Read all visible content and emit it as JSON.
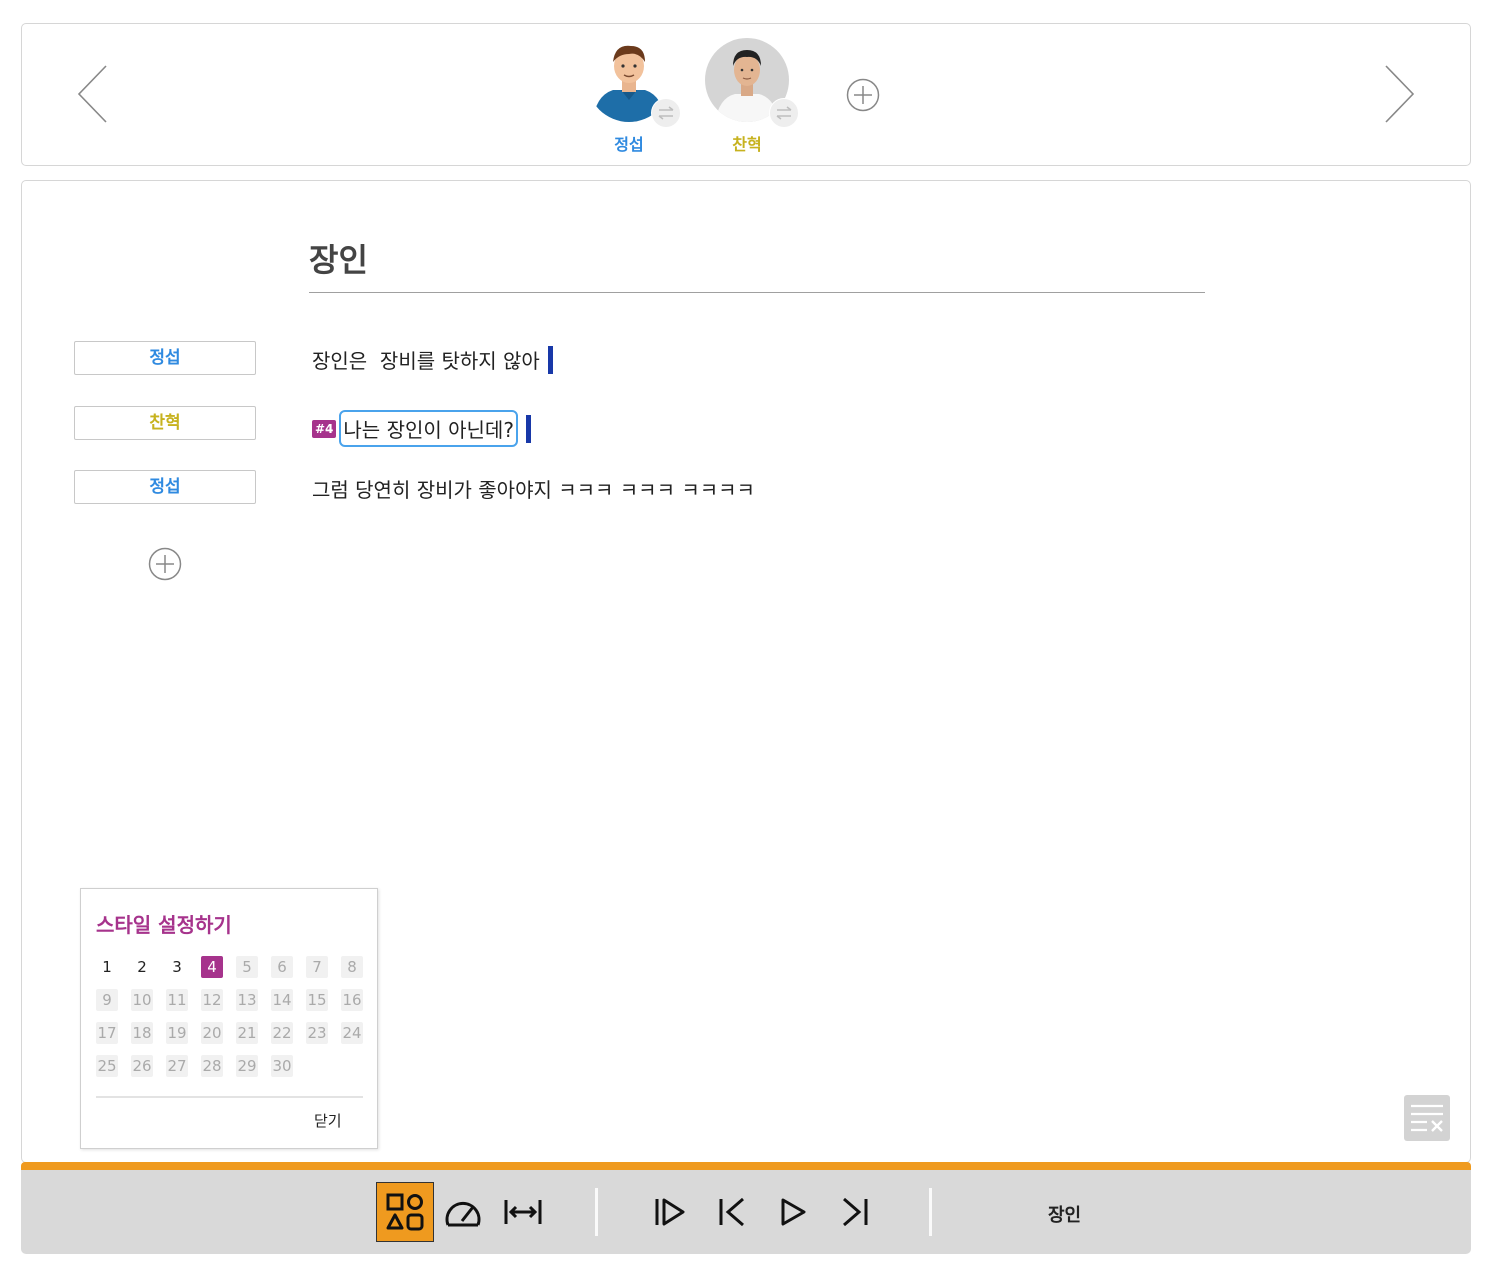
{
  "characters": [
    {
      "name": "정섭",
      "color": "#2f8ae0",
      "avatar": "cartoon-man-blue-shirt"
    },
    {
      "name": "찬혁",
      "color": "#c7b21e",
      "avatar": "photo-man-white-shirt"
    }
  ],
  "document": {
    "title": "장인",
    "lines": [
      {
        "speaker": "정섭",
        "speaker_color": "#2f8ae0",
        "text": "장인은  장비를 탓하지 않아",
        "tag": ""
      },
      {
        "speaker": "찬혁",
        "speaker_color": "#c7b21e",
        "text": "나는 장인이 아닌데?",
        "tag": "#4"
      },
      {
        "speaker": "정섭",
        "speaker_color": "#2f8ae0",
        "text": "그럼 당연히 장비가 좋아야지 ㅋㅋㅋ ㅋㅋㅋ ㅋㅋㅋㅋ",
        "tag": ""
      }
    ]
  },
  "style_popup": {
    "title": "스타일 설정하기",
    "numbers": [
      "1",
      "2",
      "3",
      "4",
      "5",
      "6",
      "7",
      "8",
      "9",
      "10",
      "11",
      "12",
      "13",
      "14",
      "15",
      "16",
      "17",
      "18",
      "19",
      "20",
      "21",
      "22",
      "23",
      "24",
      "25",
      "26",
      "27",
      "28",
      "29",
      "30"
    ],
    "selected": "4",
    "enabled_count": 4,
    "close_label": "닫기"
  },
  "toolbar": {
    "current_title": "장인",
    "buttons": [
      "shapes-icon",
      "speed-gauge-icon",
      "fit-width-icon",
      "play-from-start-icon",
      "skip-previous-icon",
      "play-icon",
      "skip-next-icon"
    ]
  },
  "colors": {
    "accent_orange": "#ef9a1f",
    "style_purple": "#a6338c",
    "caret_blue": "#1838a8",
    "selection_blue": "#4aa3ec"
  }
}
